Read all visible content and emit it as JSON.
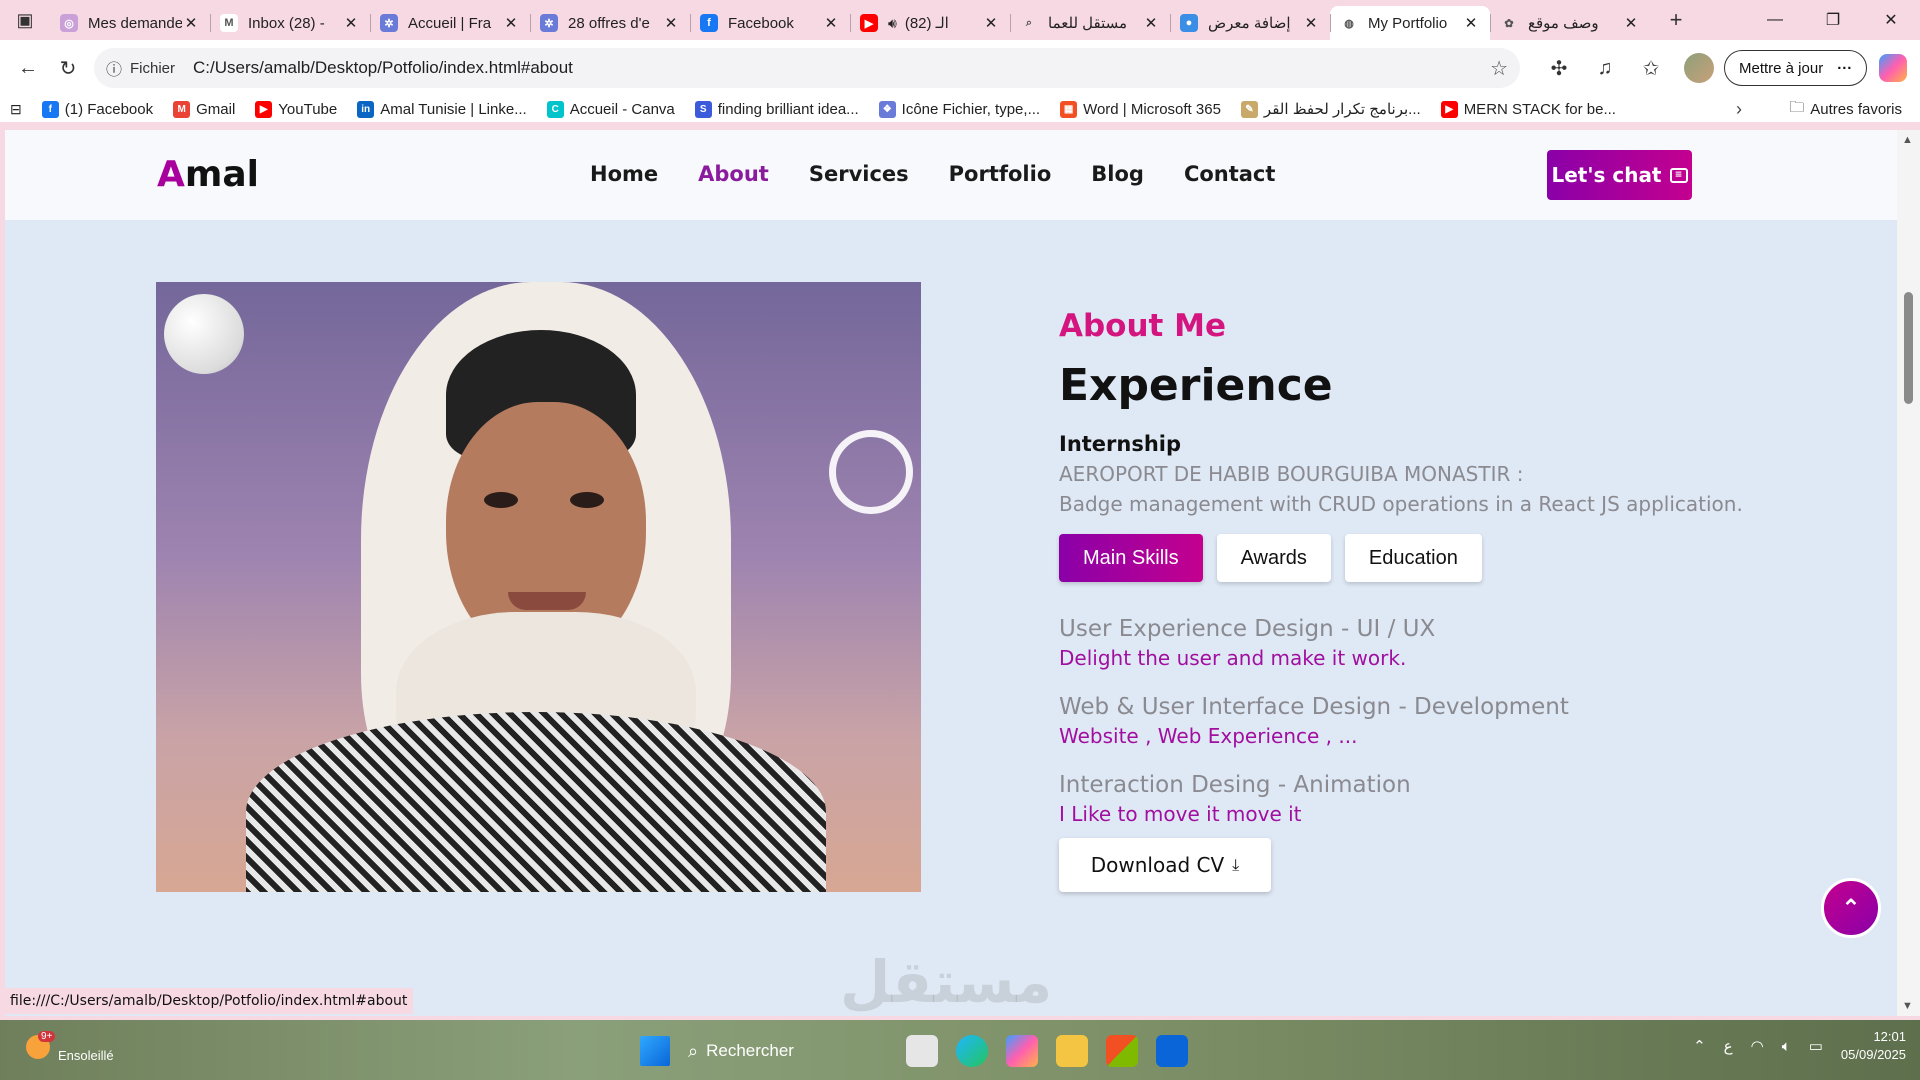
{
  "tabs": [
    {
      "title": "Mes demandes",
      "fav_color": "#c9a0d8",
      "fav_glyph": "◎"
    },
    {
      "title": "Inbox (28) -",
      "fav_color": "#ffffff",
      "fav_glyph": "M"
    },
    {
      "title": "Accueil | Fra",
      "fav_color": "#6a7ad8",
      "fav_glyph": "✲"
    },
    {
      "title": "28 offres d'e",
      "fav_color": "#6a7ad8",
      "fav_glyph": "✲"
    },
    {
      "title": "Facebook",
      "fav_color": "#1877f2",
      "fav_glyph": "f"
    },
    {
      "title": "(82) الـ",
      "fav_color": "#ff0000",
      "fav_glyph": "▶"
    },
    {
      "title": "مستقل للعما",
      "fav_color": "#f6d9e2",
      "fav_glyph": "⌕"
    },
    {
      "title": "إضافة معرض",
      "fav_color": "#3a8ee6",
      "fav_glyph": "●"
    },
    {
      "title": "My Portfolio",
      "fav_color": "#ffffff",
      "fav_glyph": "◍"
    },
    {
      "title": "وصف موقع",
      "fav_color": "#f6d9e2",
      "fav_glyph": "✿"
    }
  ],
  "active_tab_index": 8,
  "address": {
    "scheme_label": "Fichier",
    "url": "C:/Users/amalb/Desktop/Potfolio/index.html#about"
  },
  "toolbar": {
    "update_label": "Mettre à jour"
  },
  "bookmarks": [
    {
      "label": "(1) Facebook",
      "color": "#1877f2",
      "glyph": "f"
    },
    {
      "label": "Gmail",
      "color": "#ea4335",
      "glyph": "M"
    },
    {
      "label": "YouTube",
      "color": "#ff0000",
      "glyph": "▶"
    },
    {
      "label": "Amal Tunisie | Linke...",
      "color": "#0a66c2",
      "glyph": "in"
    },
    {
      "label": "Accueil - Canva",
      "color": "#00c4cc",
      "glyph": "C"
    },
    {
      "label": "finding brilliant idea...",
      "color": "#3b5bdb",
      "glyph": "S"
    },
    {
      "label": "Icône Fichier, type,...",
      "color": "#6a7ad8",
      "glyph": "❖"
    },
    {
      "label": "Word | Microsoft 365",
      "color": "#f25022",
      "glyph": "▦"
    },
    {
      "label": "برنامج تكرار لحفظ القر...",
      "color": "#c8a96a",
      "glyph": "✎"
    },
    {
      "label": "MERN STACK for be...",
      "color": "#ff0000",
      "glyph": "▶"
    }
  ],
  "bookmarks_other": "Autres favoris",
  "site": {
    "logo_first": "A",
    "logo_rest": "mal",
    "nav": [
      "Home",
      "About",
      "Services",
      "Portfolio",
      "Blog",
      "Contact"
    ],
    "nav_active": "About",
    "chat_label": "Let's chat"
  },
  "about": {
    "kicker": "About Me",
    "heading": "Experience",
    "subheading": "Internship",
    "line1": "AEROPORT DE HABIB BOURGUIBA MONASTIR :",
    "line2": "Badge management with CRUD operations in a React JS application.",
    "tabs": [
      "Main Skills",
      "Awards",
      "Education"
    ],
    "active_tab": "Main Skills",
    "skills": [
      {
        "title": "User Experience Design - UI / UX",
        "desc": "Delight the user and make it work."
      },
      {
        "title": "Web & User Interface Design - Development",
        "desc": "Website , Web Experience , ..."
      },
      {
        "title": "Interaction Desing - Animation",
        "desc": "I Like to move it move it"
      }
    ],
    "cv_label": "Download CV"
  },
  "status_url": "file:///C:/Users/amalb/Desktop/Potfolio/index.html#about",
  "watermark": "مستقل",
  "taskbar": {
    "weather_badge": "9+",
    "weather_label": "Ensoleillé",
    "search_label": "Rechercher",
    "time": "12:01",
    "date": "05/09/2025"
  },
  "colors": {
    "accent": "#a8009c",
    "kicker": "#d4157f",
    "chrome": "#f6d9e2",
    "page_bg": "#dfe9f5"
  }
}
